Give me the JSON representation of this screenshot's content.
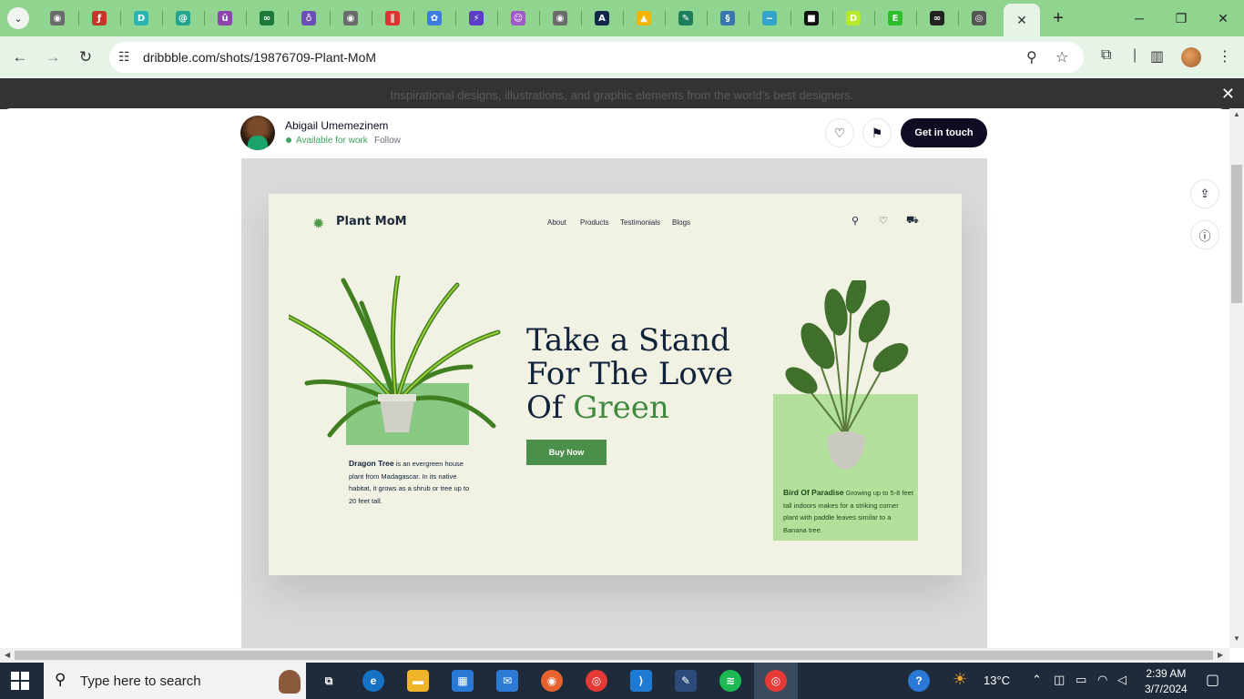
{
  "browser": {
    "url": "dribbble.com/shots/19876709-Plant-MoM",
    "tabs": [
      {
        "icon": "globe-icon",
        "color": "#6b6b6b",
        "glyph": "◉"
      },
      {
        "icon": "feather-icon",
        "color": "#c0392b",
        "glyph": "ƒ"
      },
      {
        "icon": "d-icon",
        "color": "#2ab5b5",
        "glyph": "D"
      },
      {
        "icon": "swirl-icon",
        "color": "#23a48c",
        "glyph": "@"
      },
      {
        "icon": "u-icon",
        "color": "#8e44ad",
        "glyph": "û"
      },
      {
        "icon": "infinity-icon",
        "color": "#1e7a3a",
        "glyph": "∞"
      },
      {
        "icon": "planet-icon",
        "color": "#6a4fb8",
        "glyph": "♁"
      },
      {
        "icon": "globe-icon",
        "color": "#6b6b6b",
        "glyph": "◉"
      },
      {
        "icon": "barcode-icon",
        "color": "#d33",
        "glyph": "∥"
      },
      {
        "icon": "puzzle-icon",
        "color": "#3f7ae0",
        "glyph": "✿"
      },
      {
        "icon": "bolt-icon",
        "color": "#5b3dc8",
        "glyph": "⚡"
      },
      {
        "icon": "person-icon",
        "color": "#a05ac8",
        "glyph": "☺"
      },
      {
        "icon": "globe-icon",
        "color": "#6b6b6b",
        "glyph": "◉"
      },
      {
        "icon": "font-icon",
        "color": "#10284a",
        "glyph": "A"
      },
      {
        "icon": "drive-icon",
        "color": "#f4b400",
        "glyph": "▲"
      },
      {
        "icon": "map-icon",
        "color": "#1a7f5a",
        "glyph": "✎"
      },
      {
        "icon": "python-icon",
        "color": "#3776ab",
        "glyph": "§"
      },
      {
        "icon": "wave-icon",
        "color": "#33a3c7",
        "glyph": "~"
      },
      {
        "icon": "square-icon",
        "color": "#111111",
        "glyph": "■"
      },
      {
        "icon": "d-badge-icon",
        "color": "#b6e92a",
        "glyph": "D"
      },
      {
        "icon": "e-icon",
        "color": "#2dbd2d",
        "glyph": "E"
      },
      {
        "icon": "mask-icon",
        "color": "#222222",
        "glyph": "∞"
      },
      {
        "icon": "broadcast-icon",
        "color": "#555555",
        "glyph": "◎"
      }
    ]
  },
  "overlay": {
    "tagline": "Inspirational designs, illustrations, and graphic elements from the world's best designers."
  },
  "designer": {
    "name": "Abigail Umemezinem",
    "status": "Available for work",
    "follow": "Follow",
    "cta": "Get in touch"
  },
  "mock": {
    "logo": "Plant MoM",
    "nav": [
      "About",
      "Products",
      "Testimonials",
      "Blogs"
    ],
    "headline": [
      "Take a Stand",
      "For The Love",
      "Of "
    ],
    "headline_accent": "Green",
    "button": "Buy Now",
    "plant1_name": "Dragon Tree",
    "plant1_desc": " is an evergreen house plant from Madagascar. In its native habitat, it grows as a shrub or tree up to 20 feet tall.",
    "plant2_name": "Bird Of Paradise",
    "plant2_desc": " Growing up to 5-8 feet tall indoors makes for a striking corner plant with paddle leaves similar to a Banana tree.",
    "colors": {
      "accent": "#3f8a3f",
      "background": "#f1f1e4",
      "panel_light": "#b3e09a",
      "panel_mid": "#8ac984"
    }
  },
  "taskbar": {
    "search_placeholder": "Type here to search",
    "temperature": "13°C",
    "time": "2:39 AM",
    "date": "3/7/2024"
  }
}
